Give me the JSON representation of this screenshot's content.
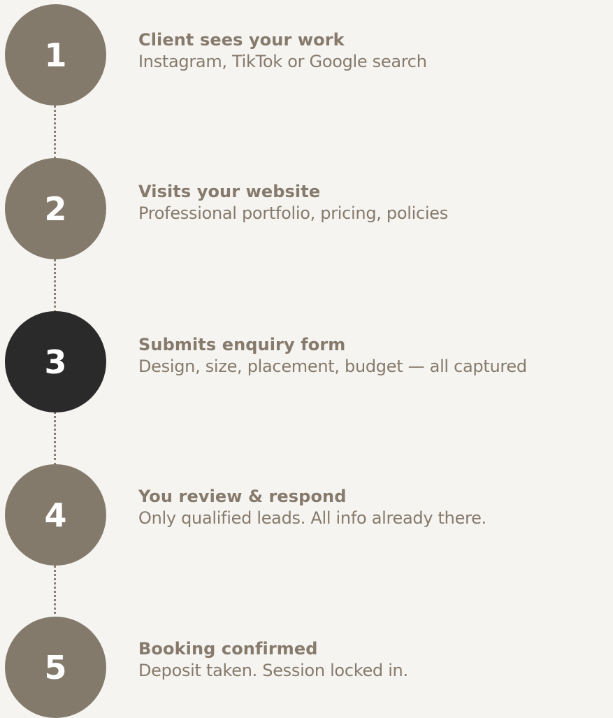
{
  "colors": {
    "background": "#f6f4f0",
    "circle_default": "#847a6c",
    "circle_active": "#2a2a2a",
    "text": "#857a6c",
    "connector": "#8a8073"
  },
  "steps": [
    {
      "number": "1",
      "title": "Client sees your work",
      "description": "Instagram, TikTok or Google search",
      "active": false
    },
    {
      "number": "2",
      "title": "Visits your website",
      "description": "Professional portfolio, pricing, policies",
      "active": false
    },
    {
      "number": "3",
      "title": "Submits enquiry form",
      "description": "Design, size, placement, budget — all captured",
      "active": true
    },
    {
      "number": "4",
      "title": "You review & respond",
      "description": "Only qualified leads. All info already there.",
      "active": false
    },
    {
      "number": "5",
      "title": "Booking confirmed",
      "description": "Deposit taken. Session locked in.",
      "active": false
    }
  ]
}
